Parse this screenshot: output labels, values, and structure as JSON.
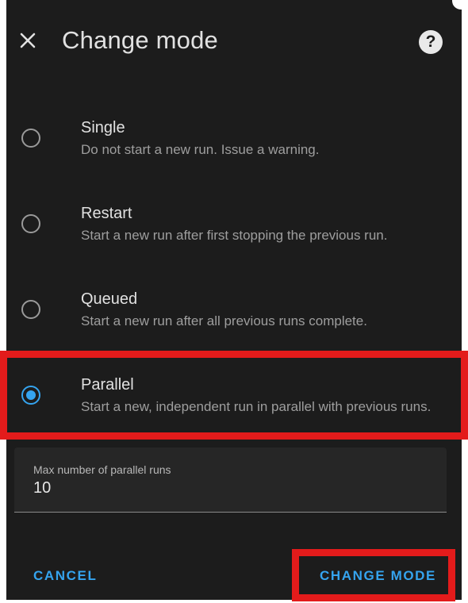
{
  "dialog": {
    "title": "Change mode",
    "close_icon": "close-icon",
    "help_icon": "help-circle-icon",
    "help_glyph": "?"
  },
  "options": [
    {
      "label": "Single",
      "description": "Do not start a new run. Issue a warning.",
      "selected": false
    },
    {
      "label": "Restart",
      "description": "Start a new run after first stopping the previous run.",
      "selected": false
    },
    {
      "label": "Queued",
      "description": "Start a new run after all previous runs complete.",
      "selected": false
    },
    {
      "label": "Parallel",
      "description": "Start a new, independent run in parallel with previous runs.",
      "selected": true
    }
  ],
  "max_runs_field": {
    "label": "Max number of parallel runs",
    "value": "10"
  },
  "actions": {
    "cancel_label": "CANCEL",
    "change_mode_label": "CHANGE MODE"
  },
  "colors": {
    "accent": "#35a4ef",
    "background": "#1c1c1c",
    "highlight": "#e31b1b"
  }
}
